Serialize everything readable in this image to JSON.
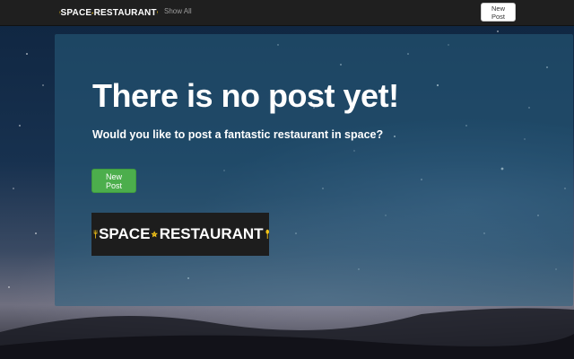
{
  "navbar": {
    "brand_part1": "SPACE",
    "brand_part2": "RESTAURANT",
    "show_all_label": "Show All",
    "new_post_label": "New Post"
  },
  "main": {
    "headline": "There is no post yet!",
    "subline": "Would you like to post a fantastic restaurant in space?",
    "new_post_label": "New Post",
    "logo_part1": "SPACE",
    "logo_part2": "RESTAURANT"
  },
  "colors": {
    "navbar_bg": "#1f1f1f",
    "brand_yellow": "#f5c518",
    "primary_green": "#4cae4c",
    "jumbotron_tint": "#285f7d"
  },
  "icons": {
    "fork": "fork-icon",
    "star": "star-icon",
    "spoon": "spoon-icon"
  }
}
